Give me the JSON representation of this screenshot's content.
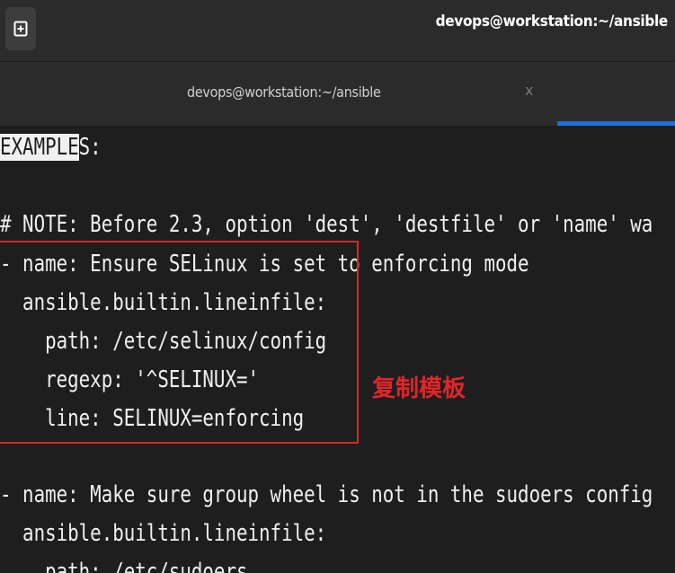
{
  "window": {
    "title": "devops@workstation:~/ansible",
    "new_tab_icon": "new-tab-icon"
  },
  "tabs": [
    {
      "label": "devops@workstation:~/ansible",
      "close": "x"
    }
  ],
  "terminal": {
    "lines": [
      {
        "highlight": "EXAMPLE",
        "rest": "S:"
      },
      "# NOTE: Before 2.3, option 'dest', 'destfile' or 'name' wa",
      "- name: Ensure SELinux is set to enforcing mode",
      "  ansible.builtin.lineinfile:",
      "    path: /etc/selinux/config",
      "    regexp: '^SELINUX='",
      "    line: SELINUX=enforcing",
      "- name: Make sure group wheel is not in the sudoers config",
      "  ansible.builtin.lineinfile:",
      "    path: /etc/sudoers"
    ]
  },
  "annotation": {
    "label": "复制模板",
    "color": "#e0262b"
  },
  "colors": {
    "titlebar_bg": "#2b2b2b",
    "terminal_bg": "#1e1e1e",
    "active_tab_indicator": "#1e6fd6",
    "text": "#f0f0f0"
  }
}
